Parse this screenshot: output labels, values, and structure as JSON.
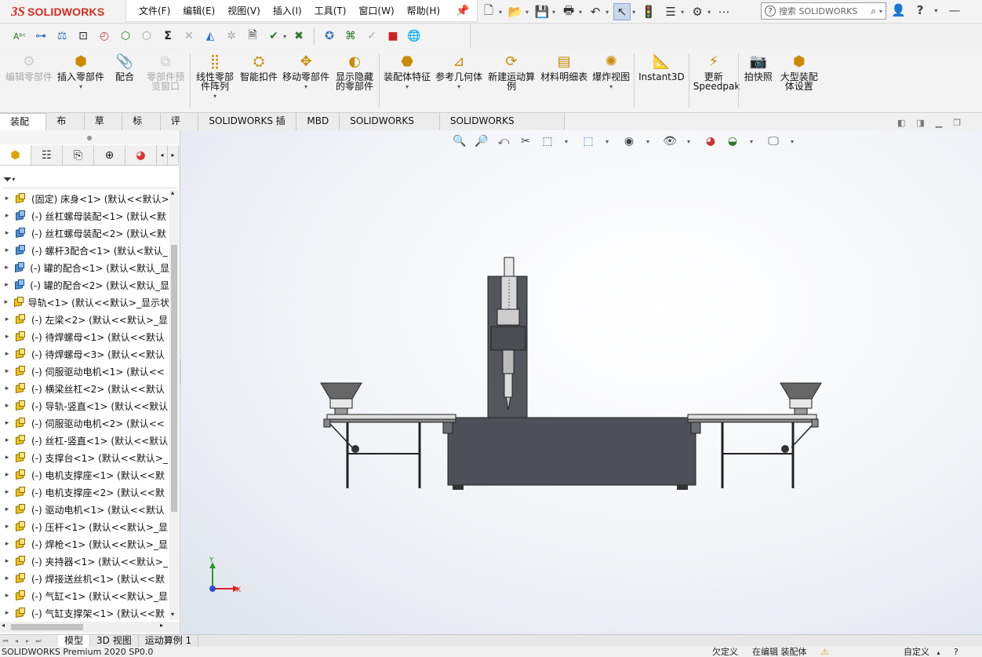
{
  "app": {
    "logo_ds": "3S",
    "logo_text": "SOLIDWORKS"
  },
  "menu": [
    "文件(F)",
    "编辑(E)",
    "视图(V)",
    "插入(I)",
    "工具(T)",
    "窗口(W)",
    "帮助(H)"
  ],
  "search": {
    "placeholder": "搜索 SOLIDWORKS"
  },
  "ribbon": [
    {
      "label": "编辑零部件",
      "disabled": true,
      "icon": "edit-component-icon",
      "dropdown": false
    },
    {
      "label": "插入零部件",
      "disabled": false,
      "icon": "insert-component-icon",
      "dropdown": true
    },
    {
      "label": "配合",
      "disabled": false,
      "icon": "mate-icon",
      "dropdown": false
    },
    {
      "label": "零部件预览窗口",
      "disabled": true,
      "icon": "preview-window-icon",
      "dropdown": false
    },
    {
      "label": "线性零部件阵列",
      "disabled": false,
      "icon": "linear-pattern-icon",
      "dropdown": true
    },
    {
      "label": "智能扣件",
      "disabled": false,
      "icon": "smart-fastener-icon",
      "dropdown": false
    },
    {
      "label": "移动零部件",
      "disabled": false,
      "icon": "move-component-icon",
      "dropdown": true
    },
    {
      "label": "显示隐藏的零部件",
      "disabled": false,
      "icon": "show-hidden-icon",
      "dropdown": false
    },
    {
      "label": "装配体特征",
      "disabled": false,
      "icon": "assembly-feature-icon",
      "dropdown": true
    },
    {
      "label": "参考几何体",
      "disabled": false,
      "icon": "reference-geometry-icon",
      "dropdown": true
    },
    {
      "label": "新建运动算例",
      "disabled": false,
      "icon": "motion-study-icon",
      "dropdown": false
    },
    {
      "label": "材料明细表",
      "disabled": false,
      "icon": "bom-icon",
      "dropdown": false
    },
    {
      "label": "爆炸视图",
      "disabled": false,
      "icon": "exploded-view-icon",
      "dropdown": true
    },
    {
      "label": "Instant3D",
      "disabled": false,
      "icon": "instant3d-icon",
      "dropdown": false
    },
    {
      "label": "更新Speedpak",
      "disabled": false,
      "icon": "speedpak-icon",
      "dropdown": false
    },
    {
      "label": "拍快照",
      "disabled": false,
      "icon": "snapshot-icon",
      "dropdown": false
    },
    {
      "label": "大型装配体设置",
      "disabled": false,
      "icon": "large-assembly-icon",
      "dropdown": false
    }
  ],
  "tabs": [
    "装配体",
    "布局",
    "草图",
    "标注",
    "评估",
    "SOLIDWORKS 插件",
    "MBD",
    "SOLIDWORKS CAM",
    "SOLIDWORKS Inspection"
  ],
  "active_tab": "装配体",
  "tree": [
    {
      "label": "(固定) 床身<1> (默认<<默认>",
      "blue": false
    },
    {
      "label": "(-) 丝杠螺母装配<1> (默认<默",
      "blue": true
    },
    {
      "label": "(-) 丝杠螺母装配<2> (默认<默",
      "blue": true
    },
    {
      "label": "(-) 螺杆3配合<1> (默认<默认_",
      "blue": true
    },
    {
      "label": "(-) 罐的配合<1> (默认<默认_显",
      "blue": true
    },
    {
      "label": "(-) 罐的配合<2> (默认<默认_显",
      "blue": true
    },
    {
      "label": "导轨<1> (默认<<默认>_显示状",
      "blue": false
    },
    {
      "label": "(-) 左梁<2> (默认<<默认>_显",
      "blue": false
    },
    {
      "label": "(-) 待焊螺母<1> (默认<<默认",
      "blue": false
    },
    {
      "label": "(-) 待焊螺母<3> (默认<<默认",
      "blue": false
    },
    {
      "label": "(-) 伺服驱动电机<1> (默认<<",
      "blue": false
    },
    {
      "label": "(-) 横梁丝杠<2> (默认<<默认",
      "blue": false
    },
    {
      "label": "(-) 导轨-竖直<1> (默认<<默认",
      "blue": false
    },
    {
      "label": "(-) 伺服驱动电机<2> (默认<<",
      "blue": false
    },
    {
      "label": "(-) 丝杠-竖直<1> (默认<<默认",
      "blue": false
    },
    {
      "label": "(-) 支撑台<1> (默认<<默认>_",
      "blue": false
    },
    {
      "label": "(-) 电机支撑座<1> (默认<<默",
      "blue": false
    },
    {
      "label": "(-) 电机支撑座<2> (默认<<默",
      "blue": false
    },
    {
      "label": "(-) 驱动电机<1> (默认<<默认",
      "blue": false
    },
    {
      "label": "(-) 压杆<1> (默认<<默认>_显",
      "blue": false
    },
    {
      "label": "(-) 焊枪<1> (默认<<默认>_显",
      "blue": false
    },
    {
      "label": "(-) 夹持器<1> (默认<<默认>_",
      "blue": false
    },
    {
      "label": "(-) 焊接送丝机<1> (默认<<默",
      "blue": false
    },
    {
      "label": "(-) 气缸<1> (默认<<默认>_显",
      "blue": false
    },
    {
      "label": "(-) 气缸支撑架<1> (默认<<默",
      "blue": false
    }
  ],
  "bottom_tabs": [
    "模型",
    "3D 视图",
    "运动算例 1"
  ],
  "active_bottom_tab": "模型",
  "status": {
    "product": "SOLIDWORKS Premium 2020 SP0.0",
    "undefined": "欠定义",
    "editing": "在编辑 装配体",
    "custom": "自定义"
  },
  "triad": {
    "y": "Y",
    "x": "X"
  },
  "colors": {
    "accent": "#d52b1e",
    "model_dark": "#4a4d52",
    "model_frame": "#55575c"
  }
}
